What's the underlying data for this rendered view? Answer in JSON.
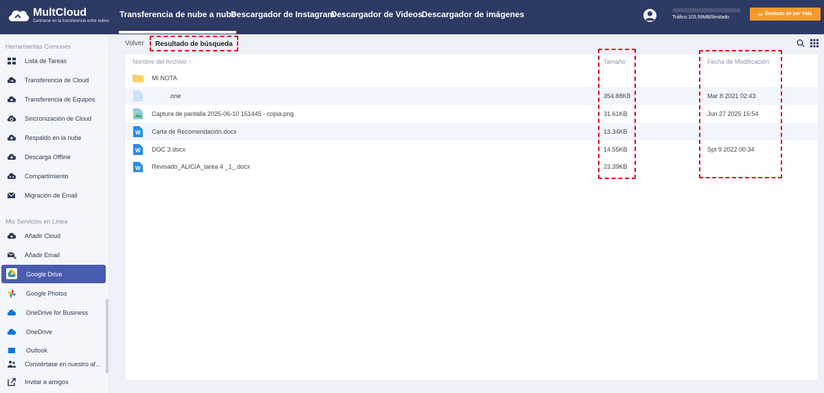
{
  "app": {
    "name": "MultCloud",
    "tagline": "Centrarse en la transferencia entre nubes"
  },
  "nav": {
    "tabs": [
      {
        "label": "Transferencia de nube a nube"
      },
      {
        "label": "Descargador de Instagram"
      },
      {
        "label": "Descargador de Videos"
      },
      {
        "label": "Descargador de imágenes"
      }
    ]
  },
  "header": {
    "traffic": "Tráfico:103.59MB/Ilimitado",
    "upgrade_label": "Ilimitado de por Vida"
  },
  "sidebar": {
    "section1": "Herramientas Comunes",
    "section2": "Mis Servicios en Línea",
    "items": [
      {
        "label": "Lista de Tareas",
        "icon": "task-list-icon"
      },
      {
        "label": "Transferencia de Cloud",
        "icon": "cloud-transfer-icon"
      },
      {
        "label": "Transferencia de Equipos",
        "icon": "team-transfer-icon"
      },
      {
        "label": "Sincronización de Cloud",
        "icon": "cloud-sync-icon"
      },
      {
        "label": "Respaldo en la nube",
        "icon": "cloud-backup-icon"
      },
      {
        "label": "Descarga Offline",
        "icon": "offline-download-icon"
      },
      {
        "label": "Compartimiento",
        "icon": "share-icon"
      },
      {
        "label": "Migración de Email",
        "icon": "email-migration-icon"
      }
    ],
    "services": [
      {
        "label": "Añadir Cloud",
        "icon": "add-cloud-icon"
      },
      {
        "label": "Añadir Email",
        "icon": "add-email-icon"
      },
      {
        "label": "Google Drive",
        "icon": "google-drive-icon"
      },
      {
        "label": "Google Photos",
        "icon": "google-photos-icon"
      },
      {
        "label": "OneDrive for Business",
        "icon": "onedrive-business-icon"
      },
      {
        "label": "OneDrive",
        "icon": "onedrive-icon"
      },
      {
        "label": "Outlook",
        "icon": "outlook-icon"
      }
    ],
    "footer": [
      {
        "label": "Conviértase en nuestro af...",
        "icon": "affiliate-icon"
      },
      {
        "label": "Invitar a amigos",
        "icon": "invite-icon"
      }
    ]
  },
  "toolbar": {
    "back_label": "Volver",
    "breadcrumb": "Resultado de búsqueda"
  },
  "table": {
    "col_name": "Nombre del Archivo ↑",
    "col_size": "Tamaño",
    "col_date": "Fecha de Modificación",
    "rows": [
      {
        "name": "MI NOTA",
        "size": "",
        "date": "",
        "type": "folder"
      },
      {
        "name": ".one",
        "size": "354.88KB",
        "date": "Mar 8 2021 02:43",
        "type": "file"
      },
      {
        "name": "Captura de pantalla 2025-06-10 151445 - copia.png",
        "size": "31.61KB",
        "date": "Jun 27 2025 15:54",
        "type": "image"
      },
      {
        "name": "Carta de Recomendación.docx",
        "size": "13.34KB",
        "date": "",
        "type": "word"
      },
      {
        "name": "DOC 3.docx",
        "size": "14.55KB",
        "date": "Spt 9 2022 00:34",
        "type": "word"
      },
      {
        "name": "Revisado_ALICIA_tarea 4 _1_.docx",
        "size": "23.39KB",
        "date": "",
        "type": "word"
      }
    ]
  },
  "colors": {
    "topbar": "#2d3a63",
    "accent": "#4a5cb0",
    "upgrade": "#f49a2c",
    "highlight": "#e0001a"
  }
}
